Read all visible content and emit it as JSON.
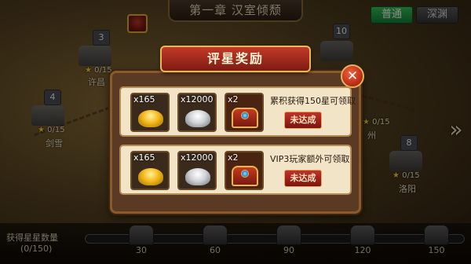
{
  "chapter_title": "第一章 汉室倾颓",
  "tabs": {
    "normal": "普通",
    "hard": "深渊"
  },
  "map": {
    "stage_numbers": [
      "3",
      "4",
      "10",
      "8"
    ],
    "progress": [
      {
        "label": "0/15"
      },
      {
        "label": "0/15"
      },
      {
        "label": "0/15"
      },
      {
        "label": "0/15"
      }
    ],
    "city_names": [
      "许昌",
      "剑雪",
      "州",
      "洛阳"
    ]
  },
  "dialog": {
    "title": "评星奖励",
    "close_icon": "close-x",
    "rows": [
      {
        "items": [
          {
            "qty": "x165",
            "icon": "gold-ingot-icon"
          },
          {
            "qty": "x12000",
            "icon": "silver-ingot-icon"
          },
          {
            "qty": "x2",
            "icon": "treasure-chest-icon"
          }
        ],
        "desc": "累积获得150星可领取",
        "status": "未达成"
      },
      {
        "items": [
          {
            "qty": "x165",
            "icon": "gold-ingot-icon"
          },
          {
            "qty": "x12000",
            "icon": "silver-ingot-icon"
          },
          {
            "qty": "x2",
            "icon": "treasure-chest-icon"
          }
        ],
        "desc": "VIP3玩家额外可领取",
        "status": "未达成"
      }
    ]
  },
  "bottom": {
    "label": "获得星星数量",
    "value": "(0/150)",
    "progress_fraction": 0.0,
    "milestones": [
      "30",
      "60",
      "90",
      "120",
      "150"
    ]
  },
  "colors": {
    "accent_red": "#c23a28",
    "gold": "#f5b81a",
    "tab_active": "#14803a"
  }
}
